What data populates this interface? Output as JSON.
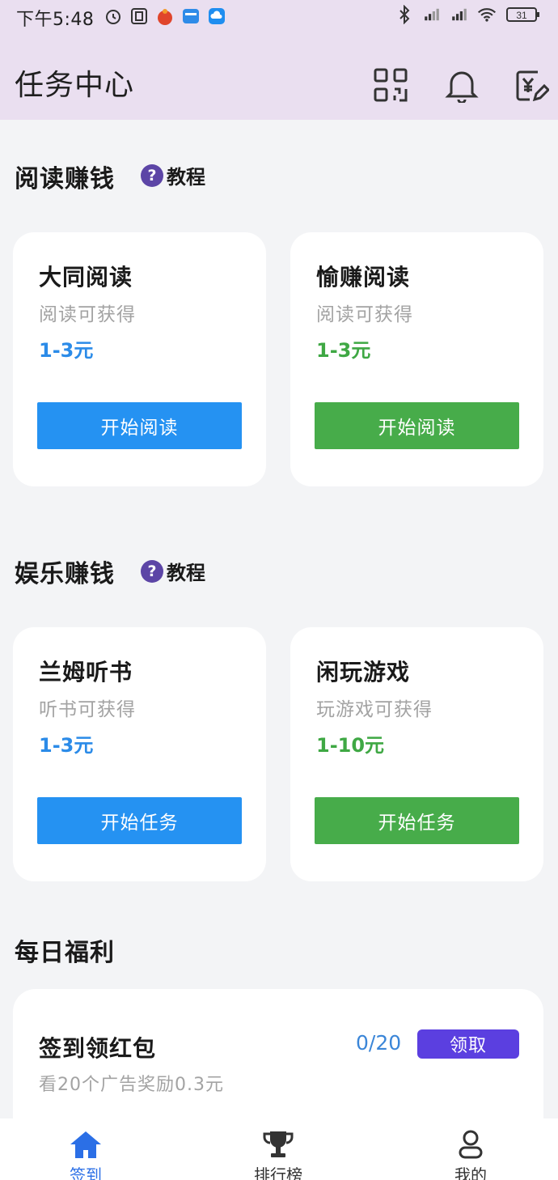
{
  "status_bar": {
    "time": "下午5:48",
    "battery": "31"
  },
  "header": {
    "title": "任务中心",
    "icons": [
      "qr-code-icon",
      "bell-icon",
      "yuan-edit-icon"
    ]
  },
  "sections": {
    "reading": {
      "title": "阅读赚钱",
      "tutorial_label": "教程",
      "cards": [
        {
          "title": "大同阅读",
          "subtitle": "阅读可获得",
          "amount": "1-3元",
          "button": "开始阅读",
          "accent": "#2592f2"
        },
        {
          "title": "愉赚阅读",
          "subtitle": "阅读可获得",
          "amount": "1-3元",
          "button": "开始阅读",
          "accent": "#47ac4a"
        }
      ]
    },
    "entertainment": {
      "title": "娱乐赚钱",
      "tutorial_label": "教程",
      "cards": [
        {
          "title": "兰姆听书",
          "subtitle": "听书可获得",
          "amount": "1-3元",
          "button": "开始任务",
          "accent": "#2592f2"
        },
        {
          "title": "闲玩游戏",
          "subtitle": "玩游戏可获得",
          "amount": "1-10元",
          "button": "开始任务",
          "accent": "#47ac4a"
        }
      ]
    },
    "daily": {
      "title": "每日福利",
      "item": {
        "title": "签到领红包",
        "subtitle": "看20个广告奖励0.3元",
        "progress": "0/20",
        "button": "领取"
      }
    }
  },
  "bottom_nav": {
    "items": [
      {
        "label": "签到",
        "icon": "home-icon",
        "active": true
      },
      {
        "label": "排行榜",
        "icon": "trophy-icon",
        "active": false
      },
      {
        "label": "我的",
        "icon": "user-icon",
        "active": false
      }
    ],
    "active_color": "#2b6fe6",
    "inactive_color": "#333333"
  }
}
